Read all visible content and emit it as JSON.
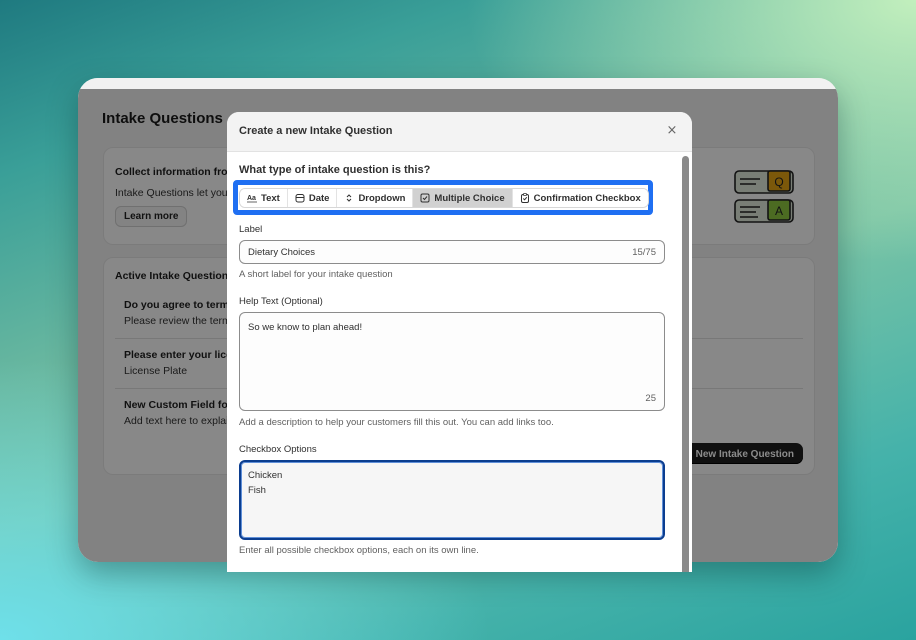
{
  "page": {
    "title": "Intake Questions",
    "info_card": {
      "title": "Collect information from",
      "description": "Intake Questions let you",
      "learn_more_label": "Learn more",
      "illustration_letters": [
        "Q",
        "A"
      ]
    },
    "active_card": {
      "title": "Active Intake Questions",
      "questions": [
        {
          "title": "Do you agree to terms",
          "subtitle": "Please review the term"
        },
        {
          "title": "Please enter your lice",
          "subtitle": "License Plate"
        },
        {
          "title": "New Custom Field for",
          "subtitle": "Add text here to explai"
        }
      ],
      "new_button_label": "New Intake Question"
    }
  },
  "modal": {
    "title": "Create a new Intake Question",
    "close_label": "×",
    "question_type_prompt": "What type of intake question is this?",
    "types": [
      {
        "label": "Text",
        "icon": "text-format-icon",
        "selected": false
      },
      {
        "label": "Date",
        "icon": "calendar-icon",
        "selected": false
      },
      {
        "label": "Dropdown",
        "icon": "select-chevrons-icon",
        "selected": false
      },
      {
        "label": "Multiple Choice",
        "icon": "checkbox-icon",
        "selected": true
      },
      {
        "label": "Confirmation Checkbox",
        "icon": "clipboard-check-icon",
        "selected": false
      }
    ],
    "highlight_color": "#1f6ff2",
    "label_field": {
      "label": "Label",
      "value": "Dietary Choices",
      "counter": "15/75",
      "help": "A short label for your intake question"
    },
    "help_text_field": {
      "label": "Help Text (Optional)",
      "value": "So we know to plan ahead!",
      "counter": "25",
      "help": "Add a description to help your customers fill this out. You can add links too."
    },
    "checkbox_options_field": {
      "label": "Checkbox Options",
      "value": "Chicken\nFish",
      "help": "Enter all possible checkbox options, each on its own line."
    }
  }
}
